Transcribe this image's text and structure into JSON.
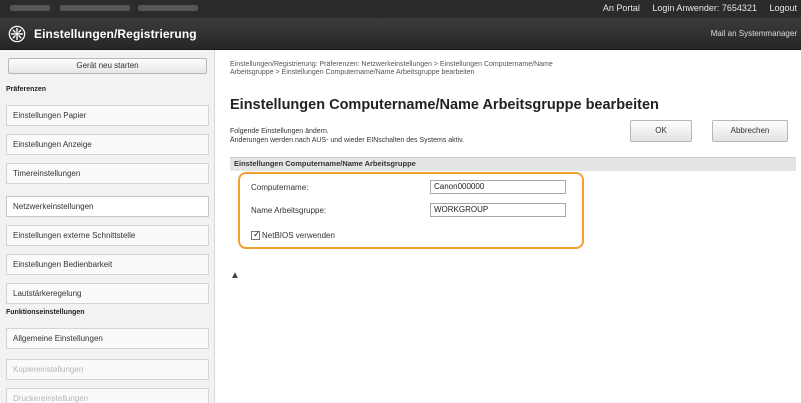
{
  "topbar": {
    "portal_label": "An Portal",
    "login_label": "Login Anwender:  7654321",
    "logout_label": "Logout"
  },
  "header": {
    "title": "Einstellungen/Registrierung",
    "mail_label": "Mail an Systemmanager",
    "icon": "settings-gear-icon"
  },
  "sidebar": {
    "restart_label": "Gerät neu starten",
    "preferences_heading": "Präferenzen",
    "function_heading": "Funktionseinstellungen",
    "items": [
      {
        "label": "Einstellungen Papier"
      },
      {
        "label": "Einstellungen Anzeige"
      },
      {
        "label": "Timereinstellungen"
      },
      {
        "label": "Netzwerkeinstellungen"
      },
      {
        "label": "Einstellungen externe Schnittstelle"
      },
      {
        "label": "Einstellungen Bedienbarkeit"
      },
      {
        "label": "Lautstärkeregelung"
      }
    ],
    "function_items": [
      {
        "label": "Allgemeine Einstellungen"
      },
      {
        "label": "Kopiereinstellungen"
      },
      {
        "label": "Druckereinstellungen"
      }
    ]
  },
  "main": {
    "breadcrumb_line1": "Einstellungen/Registrierung: Präferenzen: Netzwerkeinstellungen > Einstellungen Computername/Name",
    "breadcrumb_line2": "Arbeitsgruppe > Einstellungen Computername/Name Arbeitsgruppe bearbeiten",
    "page_title": "Einstellungen Computername/Name Arbeitsgruppe bearbeiten",
    "intro_line1": "Folgende Einstellungen ändern.",
    "intro_line2": "Änderungen werden nach AUS- und wieder EINschalten des Systems aktiv.",
    "ok_label": "OK",
    "cancel_label": "Abbrechen",
    "section_title": "Einstellungen Computername/Name Arbeitsgruppe",
    "computer_name_label": "Computername:",
    "computer_name_value": "Canon000000",
    "workgroup_label": "Name Arbeitsgruppe:",
    "workgroup_value": "WORKGROUP",
    "netbios_label": "NetBIOS verwenden",
    "netbios_checked": true,
    "top_link": "▲"
  },
  "colors": {
    "highlight": "#f0a030",
    "header_bg": "#2b2b2b"
  }
}
